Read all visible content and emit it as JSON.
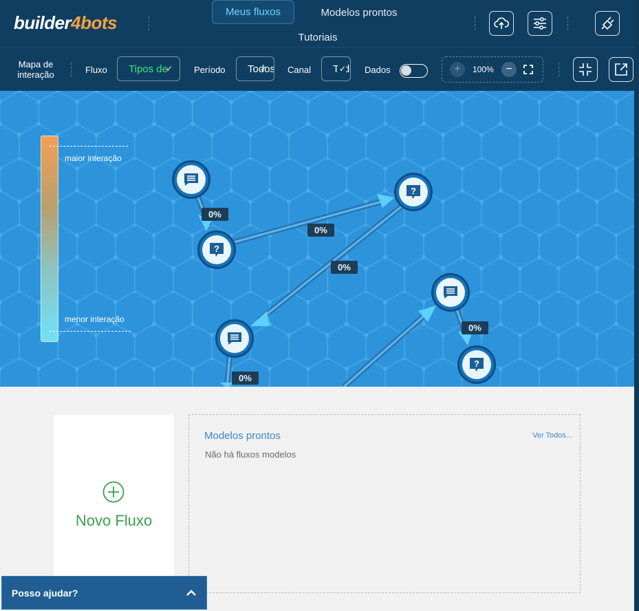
{
  "header": {
    "logo_main": "builder",
    "logo_accent": "4bots",
    "tabs": [
      {
        "label": "Meus fluxos",
        "active": true
      },
      {
        "label": "Modelos prontos",
        "active": false
      },
      {
        "label": "Tutoriais",
        "active": false
      }
    ],
    "icons": [
      "cloud-upload-icon",
      "sliders-icon",
      "plug-icon"
    ]
  },
  "toolbar": {
    "mapa_label": "Mapa de interação",
    "fluxo_label": "Fluxo",
    "fluxo_value": "Tipos de",
    "periodo_label": "Período",
    "periodo_value": "Todos",
    "canal_label": "Canal",
    "canal_value": "Todos",
    "dados_label": "Dados",
    "dados_enabled": false,
    "zoom": "100%"
  },
  "canvas": {
    "legend_max": "maior interação",
    "legend_min": "menor interação",
    "edge_labels": [
      "0%",
      "0%",
      "0%",
      "0%",
      "0%"
    ],
    "nodes": [
      {
        "type": "message"
      },
      {
        "type": "question"
      },
      {
        "type": "question"
      },
      {
        "type": "message"
      },
      {
        "type": "message"
      },
      {
        "type": "question"
      }
    ]
  },
  "bottom": {
    "novo_fluxo": "Novo Fluxo",
    "modelos_title": "Modelos prontos",
    "ver_todos": "Ver Todos...",
    "empty_text": "Não há fluxos modelos"
  },
  "help": {
    "label": "Posso ajudar?"
  },
  "colors": {
    "header_bg": "#0f3e61",
    "canvas_bg": "#2d94dc",
    "accent_green": "#3aa14a",
    "logo_orange": "#f3a23c",
    "active_tab": "#6fd3ff"
  }
}
